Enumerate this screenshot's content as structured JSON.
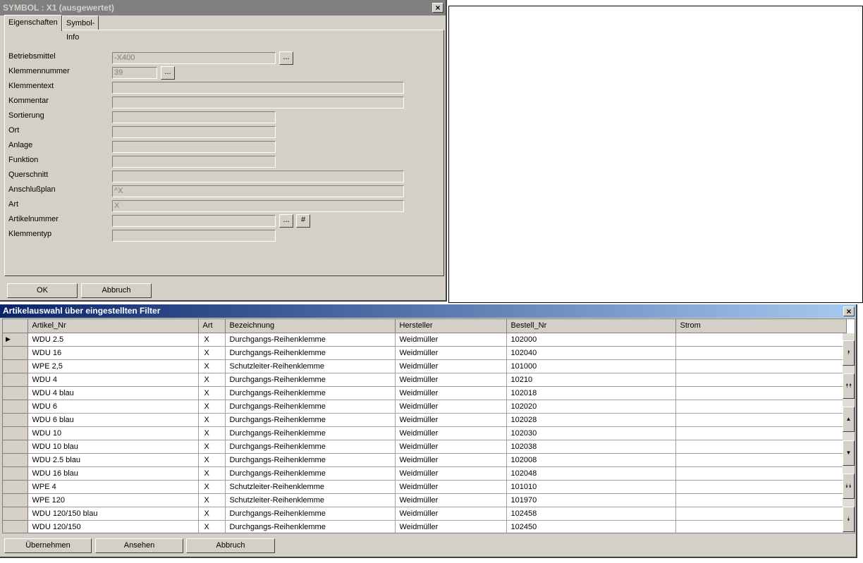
{
  "symbol_dialog": {
    "title": "SYMBOL : X1  (ausgewertet)",
    "close_label": "×",
    "tabs": [
      "Eigenschaften",
      "Symbol-Info"
    ],
    "fields": {
      "betriebsmittel": {
        "label": "Betriebsmittel",
        "value": "-X400"
      },
      "klemmennummer": {
        "label": "Klemmennummer",
        "value": "39"
      },
      "klemmentext": {
        "label": "Klemmentext",
        "value": ""
      },
      "kommentar": {
        "label": "Kommentar",
        "value": ""
      },
      "sortierung": {
        "label": "Sortierung",
        "value": ""
      },
      "ort": {
        "label": "Ort",
        "value": ""
      },
      "anlage": {
        "label": "Anlage",
        "value": ""
      },
      "funktion": {
        "label": "Funktion",
        "value": ""
      },
      "querschnitt": {
        "label": "Querschnitt",
        "value": ""
      },
      "anschlussplan": {
        "label": "Anschlußplan",
        "value": "^X"
      },
      "art": {
        "label": "Art",
        "value": "X"
      },
      "artikelnummer": {
        "label": "Artikelnummer",
        "value": ""
      },
      "klemmentyp": {
        "label": "Klemmentyp",
        "value": ""
      }
    },
    "dots_label": "...",
    "hash_label": "#",
    "ok_label": "OK",
    "cancel_label": "Abbruch"
  },
  "article_dialog": {
    "title": "Artikelauswahl über eingestellten Filter",
    "close_label": "×",
    "columns": [
      "Artikel_Nr",
      "Art",
      "Bezeichnung",
      "Hersteller",
      "Bestell_Nr",
      "Strom"
    ],
    "rows": [
      [
        "WDU 2.5",
        "X",
        "Durchgangs-Reihenklemme",
        "Weidmüller",
        "102000",
        ""
      ],
      [
        "WDU 16",
        "X",
        "Durchgangs-Reihenklemme",
        "Weidmüller",
        "102040",
        ""
      ],
      [
        "WPE 2,5",
        "X",
        "Schutzleiter-Reihenklemme",
        "Weidmüller",
        "101000",
        ""
      ],
      [
        "WDU 4",
        "X",
        "Durchgangs-Reihenklemme",
        "Weidmüller",
        "10210",
        ""
      ],
      [
        "WDU 4 blau",
        "X",
        "Durchgangs-Reihenklemme",
        "Weidmüller",
        "102018",
        ""
      ],
      [
        "WDU 6",
        "X",
        "Durchgangs-Reihenklemme",
        "Weidmüller",
        "102020",
        ""
      ],
      [
        "WDU 6 blau",
        "X",
        "Durchgangs-Reihenklemme",
        "Weidmüller",
        "102028",
        ""
      ],
      [
        "WDU 10",
        "X",
        "Durchgangs-Reihenklemme",
        "Weidmüller",
        "102030",
        ""
      ],
      [
        "WDU 10 blau",
        "X",
        "Durchgangs-Reihenklemme",
        "Weidmüller",
        "102038",
        ""
      ],
      [
        "WDU 2.5 blau",
        "X",
        "Durchgangs-Reihenklemme",
        "Weidmüller",
        "102008",
        ""
      ],
      [
        "WDU 16 blau",
        "X",
        "Durchgangs-Reihenklemme",
        "Weidmüller",
        "102048",
        ""
      ],
      [
        "WPE 4",
        "X",
        "Schutzleiter-Reihenklemme",
        "Weidmüller",
        "101010",
        ""
      ],
      [
        "WPE 120",
        "X",
        "Schutzleiter-Reihenklemme",
        "Weidmüller",
        "101970",
        ""
      ],
      [
        "WDU 120/150 blau",
        "X",
        "Durchgangs-Reihenklemme",
        "Weidmüller",
        "102458",
        ""
      ],
      [
        "WDU 120/150",
        "X",
        "Durchgangs-Reihenklemme",
        "Weidmüller",
        "102450",
        ""
      ]
    ],
    "current_row_marker": "▶",
    "scroll_icons": [
      "⯭",
      "⯭⯭",
      "▲",
      "▼",
      "⯯⯯",
      "⯯"
    ],
    "buttons": {
      "accept": "Übernehmen",
      "view": "Ansehen",
      "cancel": "Abbruch"
    }
  }
}
